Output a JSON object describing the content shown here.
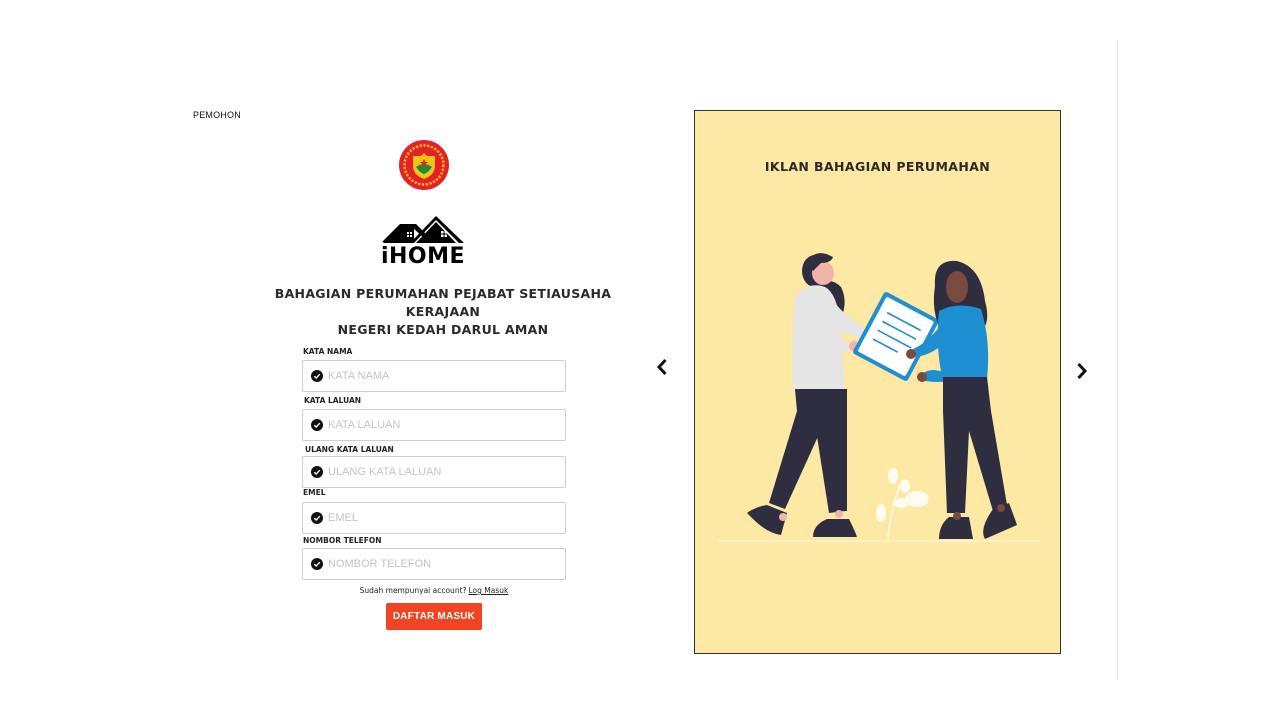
{
  "header": {
    "role_label": "PEMOHON"
  },
  "brand": {
    "name": "iHOME"
  },
  "organization": {
    "line1": "BAHAGIAN PERUMAHAN PEJABAT SETIAUSAHA KERAJAAN",
    "line2": "NEGERI KEDAH DARUL AMAN"
  },
  "form": {
    "fields": [
      {
        "label": "KATA NAMA",
        "placeholder": "KATA NAMA",
        "value": "",
        "type": "text"
      },
      {
        "label": "KATA LALUAN",
        "placeholder": "KATA LALUAN",
        "value": "",
        "type": "password"
      },
      {
        "label": "ULANG KATA LALUAN",
        "placeholder": "ULANG KATA LALUAN",
        "value": "",
        "type": "password"
      },
      {
        "label": "EMEL",
        "placeholder": "EMEL",
        "value": "",
        "type": "email"
      },
      {
        "label": "NOMBOR TELEFON",
        "placeholder": "NOMBOR TELEFON",
        "value": "",
        "type": "tel"
      }
    ],
    "account_prompt": "Sudah mempunyai account?",
    "login_link": "Log Masuk",
    "submit_label": "DAFTAR  MASUK"
  },
  "carousel": {
    "slide_title": "IKLAN BAHAGIAN PERUMAHAN",
    "prev_icon": "chevron-left-icon",
    "next_icon": "chevron-right-icon"
  },
  "colors": {
    "accent": "#f04423",
    "ad_background": "#fde9a4",
    "crest_red": "#e4202a",
    "crest_gold": "#f2c417",
    "crest_green": "#1f8a3a",
    "figure_blue": "#1e8fd0",
    "figure_dark": "#2f2e41"
  }
}
